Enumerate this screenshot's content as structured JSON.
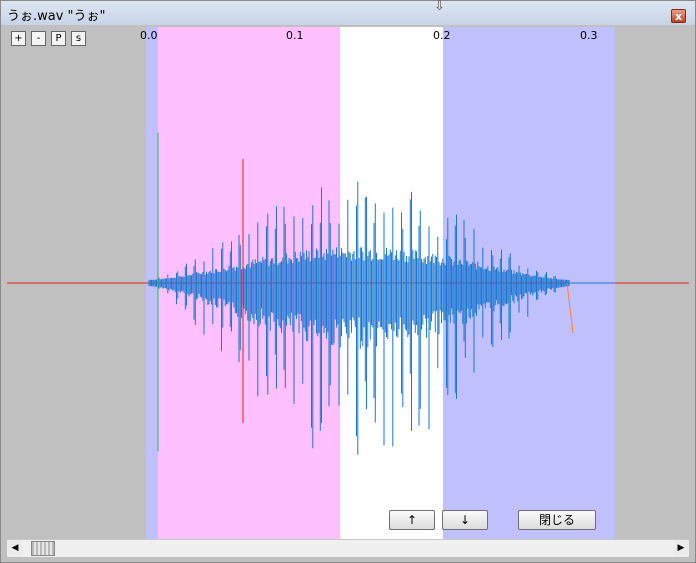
{
  "window": {
    "title": "うぉ.wav \"うぉ\"",
    "close_label": "x"
  },
  "toolbar": {
    "zoom_in": "+",
    "zoom_out": "-",
    "p_label": "P",
    "s_label": "s"
  },
  "axis": {
    "ticks": [
      "0.0",
      "0.1",
      "0.2",
      "0.3"
    ]
  },
  "buttons": {
    "up": "↑",
    "down": "↓",
    "close": "閉じる"
  },
  "scrollbar": {
    "left_arrow": "◀",
    "right_arrow": "▶"
  },
  "colors": {
    "background": "#c0c0c0",
    "region_left_lilac": "#c0c0ff",
    "region_pink": "#ffc0ff",
    "region_white": "#ffffff",
    "region_right_lilac": "#c0c0ff",
    "waveform": "#1e78d2",
    "marker_red": "#e02020",
    "marker_green": "#20c040",
    "tail_orange": "#ff8020"
  }
}
